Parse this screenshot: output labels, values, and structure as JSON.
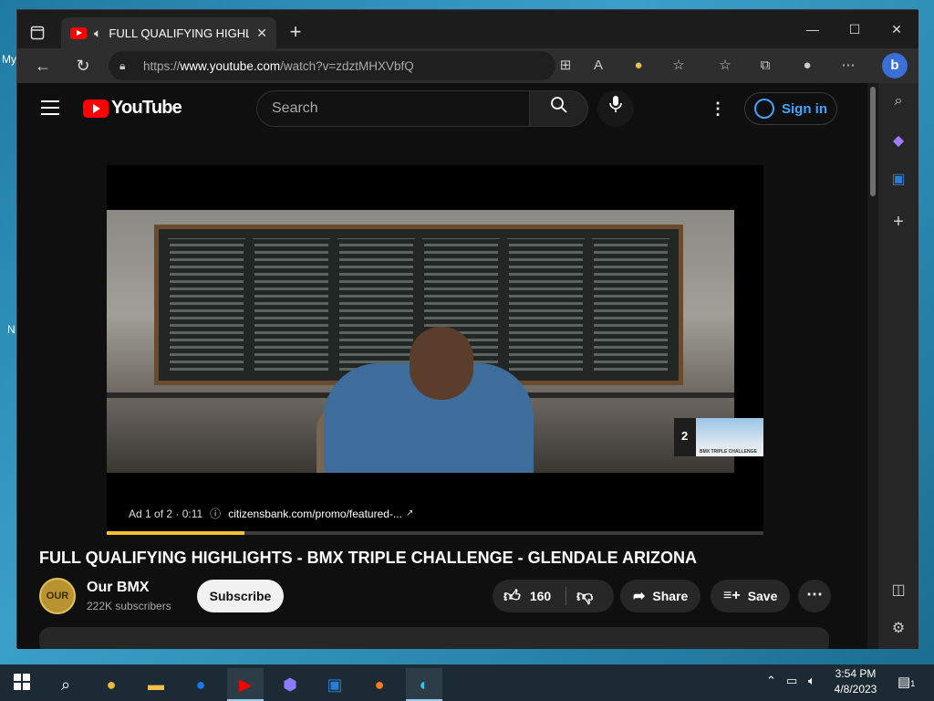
{
  "desktop": {
    "labels": [
      "My",
      "N"
    ]
  },
  "browser": {
    "tab_title": "FULL QUALIFYING HIGHLIGHTS",
    "url_prefix": "https://",
    "url_host": "www.youtube.com",
    "url_path": "/watch?v=zdztMHXVbfQ",
    "new_tab": "+",
    "min": "—",
    "max": "☐",
    "close": "✕"
  },
  "youtube": {
    "logo_text": "YouTube",
    "search_placeholder": "Search",
    "sign_in": "Sign in"
  },
  "ad": {
    "label": "Ad 1 of 2 · 0:11",
    "url": "citizensbank.com/promo/featured-...",
    "progress": 0.21,
    "next_count": "2",
    "next_thumb_text": "BMX TRIPLE CHALLENGE"
  },
  "video": {
    "title": "FULL QUALIFYING HIGHLIGHTS - BMX TRIPLE CHALLENGE - GLENDALE ARIZONA",
    "channel": "Our BMX",
    "channel_avatar": "OUR BMX",
    "subscribers": "222K subscribers",
    "subscribe": "Subscribe",
    "likes": "160",
    "share": "Share",
    "save": "Save"
  },
  "taskbar": {
    "time": "3:54 PM",
    "date": "4/8/2023",
    "notifications": "1"
  },
  "colors": {
    "accent": "#3ea6ff",
    "youtube_red": "#ff0000",
    "ad_progress": "#fbc02d"
  }
}
